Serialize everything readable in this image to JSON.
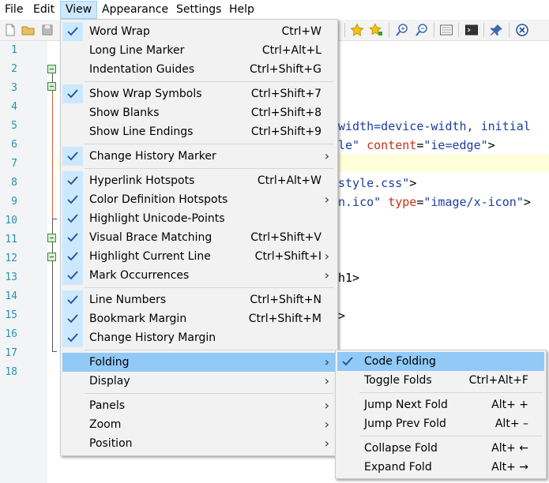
{
  "menubar": [
    "File",
    "Edit",
    "View",
    "Appearance",
    "Settings",
    "Help"
  ],
  "line_numbers": [
    "1",
    "2",
    "3",
    "4",
    "5",
    "6",
    "7",
    "8",
    "9",
    "10",
    "11",
    "12",
    "13",
    "14",
    "15",
    "16",
    "17",
    "18"
  ],
  "code_fragments": [
    {
      "text": "width=device-width, initial",
      "color": "#1c3ea0"
    },
    {
      "text": "le\"",
      "color": "#1c3ea0"
    },
    {
      "text": "content",
      "color": "#c03418"
    },
    {
      "text": "=",
      "color": "#000000"
    },
    {
      "text": "\"ie=edge\"",
      "color": "#1c3ea0"
    },
    {
      "text": ">",
      "color": "#000000"
    },
    {
      "text": "style.css\"",
      "color": "#1c3ea0"
    },
    {
      "text": ">",
      "color": "#000000"
    },
    {
      "text": "n.ico\"",
      "color": "#1c3ea0"
    },
    {
      "text": "type",
      "color": "#c03418"
    },
    {
      "text": "=",
      "color": "#000000"
    },
    {
      "text": "\"image/x-icon\"",
      "color": "#1c3ea0"
    },
    {
      "text": ">",
      "color": "#000000"
    },
    {
      "text": "h1>",
      "color": "#000000"
    },
    {
      "text": ">",
      "color": "#000000"
    }
  ],
  "view_menu": [
    {
      "label": "Word Wrap",
      "shortcut": "Ctrl+W",
      "checked": true
    },
    {
      "label": "Long Line Marker",
      "shortcut": "Ctrl+Alt+L",
      "checked": false
    },
    {
      "label": "Indentation Guides",
      "shortcut": "Ctrl+Shift+G",
      "checked": false
    },
    {
      "label": "Show Wrap Symbols",
      "shortcut": "Ctrl+Shift+7",
      "checked": true
    },
    {
      "label": "Show Blanks",
      "shortcut": "Ctrl+Shift+8",
      "checked": false
    },
    {
      "label": "Show Line Endings",
      "shortcut": "Ctrl+Shift+9",
      "checked": false
    },
    {
      "label": "Change History Marker",
      "shortcut": "",
      "checked": true,
      "submenu": true
    },
    {
      "label": "Hyperlink Hotspots",
      "shortcut": "Ctrl+Alt+W",
      "checked": true
    },
    {
      "label": "Color Definition Hotspots",
      "shortcut": "",
      "checked": true,
      "submenu": true
    },
    {
      "label": "Highlight Unicode-Points",
      "shortcut": "",
      "checked": true
    },
    {
      "label": "Visual Brace Matching",
      "shortcut": "Ctrl+Shift+V",
      "checked": true
    },
    {
      "label": "Highlight Current Line",
      "shortcut": "Ctrl+Shift+I",
      "checked": true,
      "submenu": true
    },
    {
      "label": "Mark Occurrences",
      "shortcut": "",
      "checked": true,
      "submenu": true
    },
    {
      "label": "Line Numbers",
      "shortcut": "Ctrl+Shift+N",
      "checked": true
    },
    {
      "label": "Bookmark Margin",
      "shortcut": "Ctrl+Shift+M",
      "checked": true
    },
    {
      "label": "Change History Margin",
      "shortcut": "",
      "checked": true
    },
    {
      "label": "Folding",
      "shortcut": "",
      "checked": false,
      "submenu": true,
      "highlighted": true
    },
    {
      "label": "Display",
      "shortcut": "",
      "checked": false,
      "submenu": true
    },
    {
      "label": "Panels",
      "shortcut": "",
      "checked": false,
      "submenu": true
    },
    {
      "label": "Zoom",
      "shortcut": "",
      "checked": false,
      "submenu": true
    },
    {
      "label": "Position",
      "shortcut": "",
      "checked": false,
      "submenu": true
    }
  ],
  "folding_menu": [
    {
      "label": "Code Folding",
      "shortcut": "",
      "checked": true,
      "highlighted": true
    },
    {
      "label": "Toggle Folds",
      "shortcut": "Ctrl+Alt+F",
      "checked": false
    },
    {
      "label": "Jump Next Fold",
      "shortcut": "Alt+ +",
      "checked": false
    },
    {
      "label": "Jump Prev Fold",
      "shortcut": "Alt+ –",
      "checked": false
    },
    {
      "label": "Collapse Fold",
      "shortcut": "Alt+ ←",
      "checked": false
    },
    {
      "label": "Expand Fold",
      "shortcut": "Alt+ →",
      "checked": false
    }
  ],
  "toolbar_icons": [
    "new-file-icon",
    "open-folder-icon",
    "save-icon",
    "star-icon",
    "star-add-icon",
    "zoom-in-icon",
    "zoom-out-icon",
    "window-icon",
    "console-icon",
    "pin-icon",
    "close-circle-icon"
  ]
}
